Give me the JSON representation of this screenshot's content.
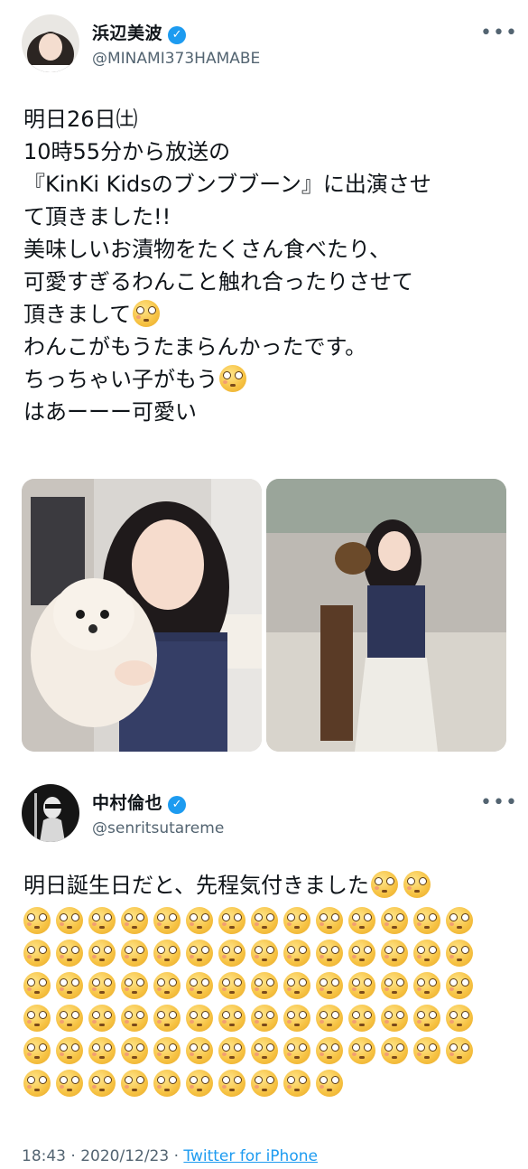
{
  "tweet1": {
    "author_name": "浜辺美波",
    "author_handle": "@MINAMI373HAMABE",
    "lines": [
      "明日26日㈯",
      "10時55分から放送の",
      "『KinKi Kidsのブンブブーン』に出演させ",
      "て頂きました!!",
      "美味しいお漬物をたくさん食べたり、",
      "可愛すぎるわんこと触れ合ったりさせて",
      "頂きまして",
      "わんこがもうたまらんかったです。",
      "ちっちゃい子がもう",
      "はあーーー可愛い"
    ]
  },
  "tweet2": {
    "author_name": "中村倫也",
    "author_handle": "@senritsutareme",
    "first_line": "明日誕生日だと、先程気付きました"
  },
  "footer": {
    "time": "18:43 · 2020/12/23 · ",
    "source": "Twitter for iPhone"
  },
  "icons": {
    "verified": "verified-badge-icon",
    "more": "more-options-icon",
    "emoji": "flushed-face-emoji"
  },
  "colors": {
    "accent": "#1d9bf0",
    "muted": "#536471",
    "text": "#0f1419"
  }
}
